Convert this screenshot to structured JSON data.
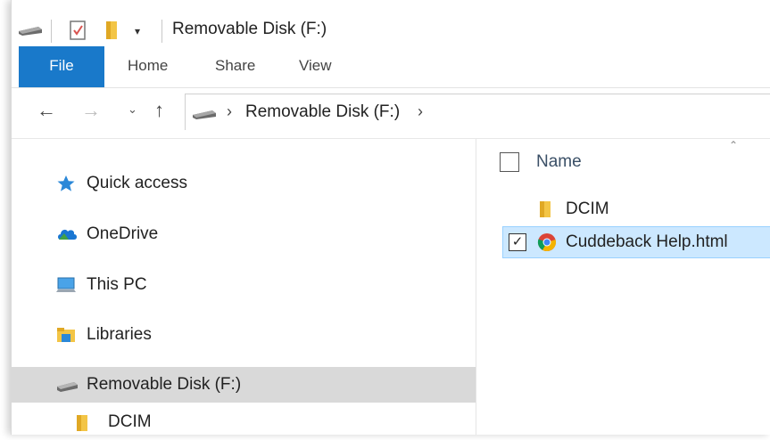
{
  "window": {
    "title": "Removable Disk (F:)"
  },
  "ribbon": {
    "tabs": [
      "File",
      "Home",
      "Share",
      "View"
    ]
  },
  "address": {
    "path": "Removable Disk (F:)"
  },
  "navpane": {
    "items": [
      {
        "label": "Quick access",
        "icon": "star-icon"
      },
      {
        "label": "OneDrive",
        "icon": "cloud-icon"
      },
      {
        "label": "This PC",
        "icon": "computer-icon"
      },
      {
        "label": "Libraries",
        "icon": "libraries-icon"
      },
      {
        "label": "Removable Disk (F:)",
        "icon": "drive-icon",
        "selected": true
      },
      {
        "label": "DCIM",
        "icon": "folder-icon"
      }
    ]
  },
  "content": {
    "column_header": "Name",
    "files": [
      {
        "name": "DCIM",
        "type": "folder",
        "icon": "folder-icon"
      },
      {
        "name": "Cuddeback Help.html",
        "type": "html",
        "icon": "chrome-icon",
        "selected": true,
        "checked": true
      }
    ]
  },
  "colors": {
    "file_tab": "#1979ca",
    "selection": "#cce8ff",
    "nav_selected": "#d9d9d9"
  }
}
